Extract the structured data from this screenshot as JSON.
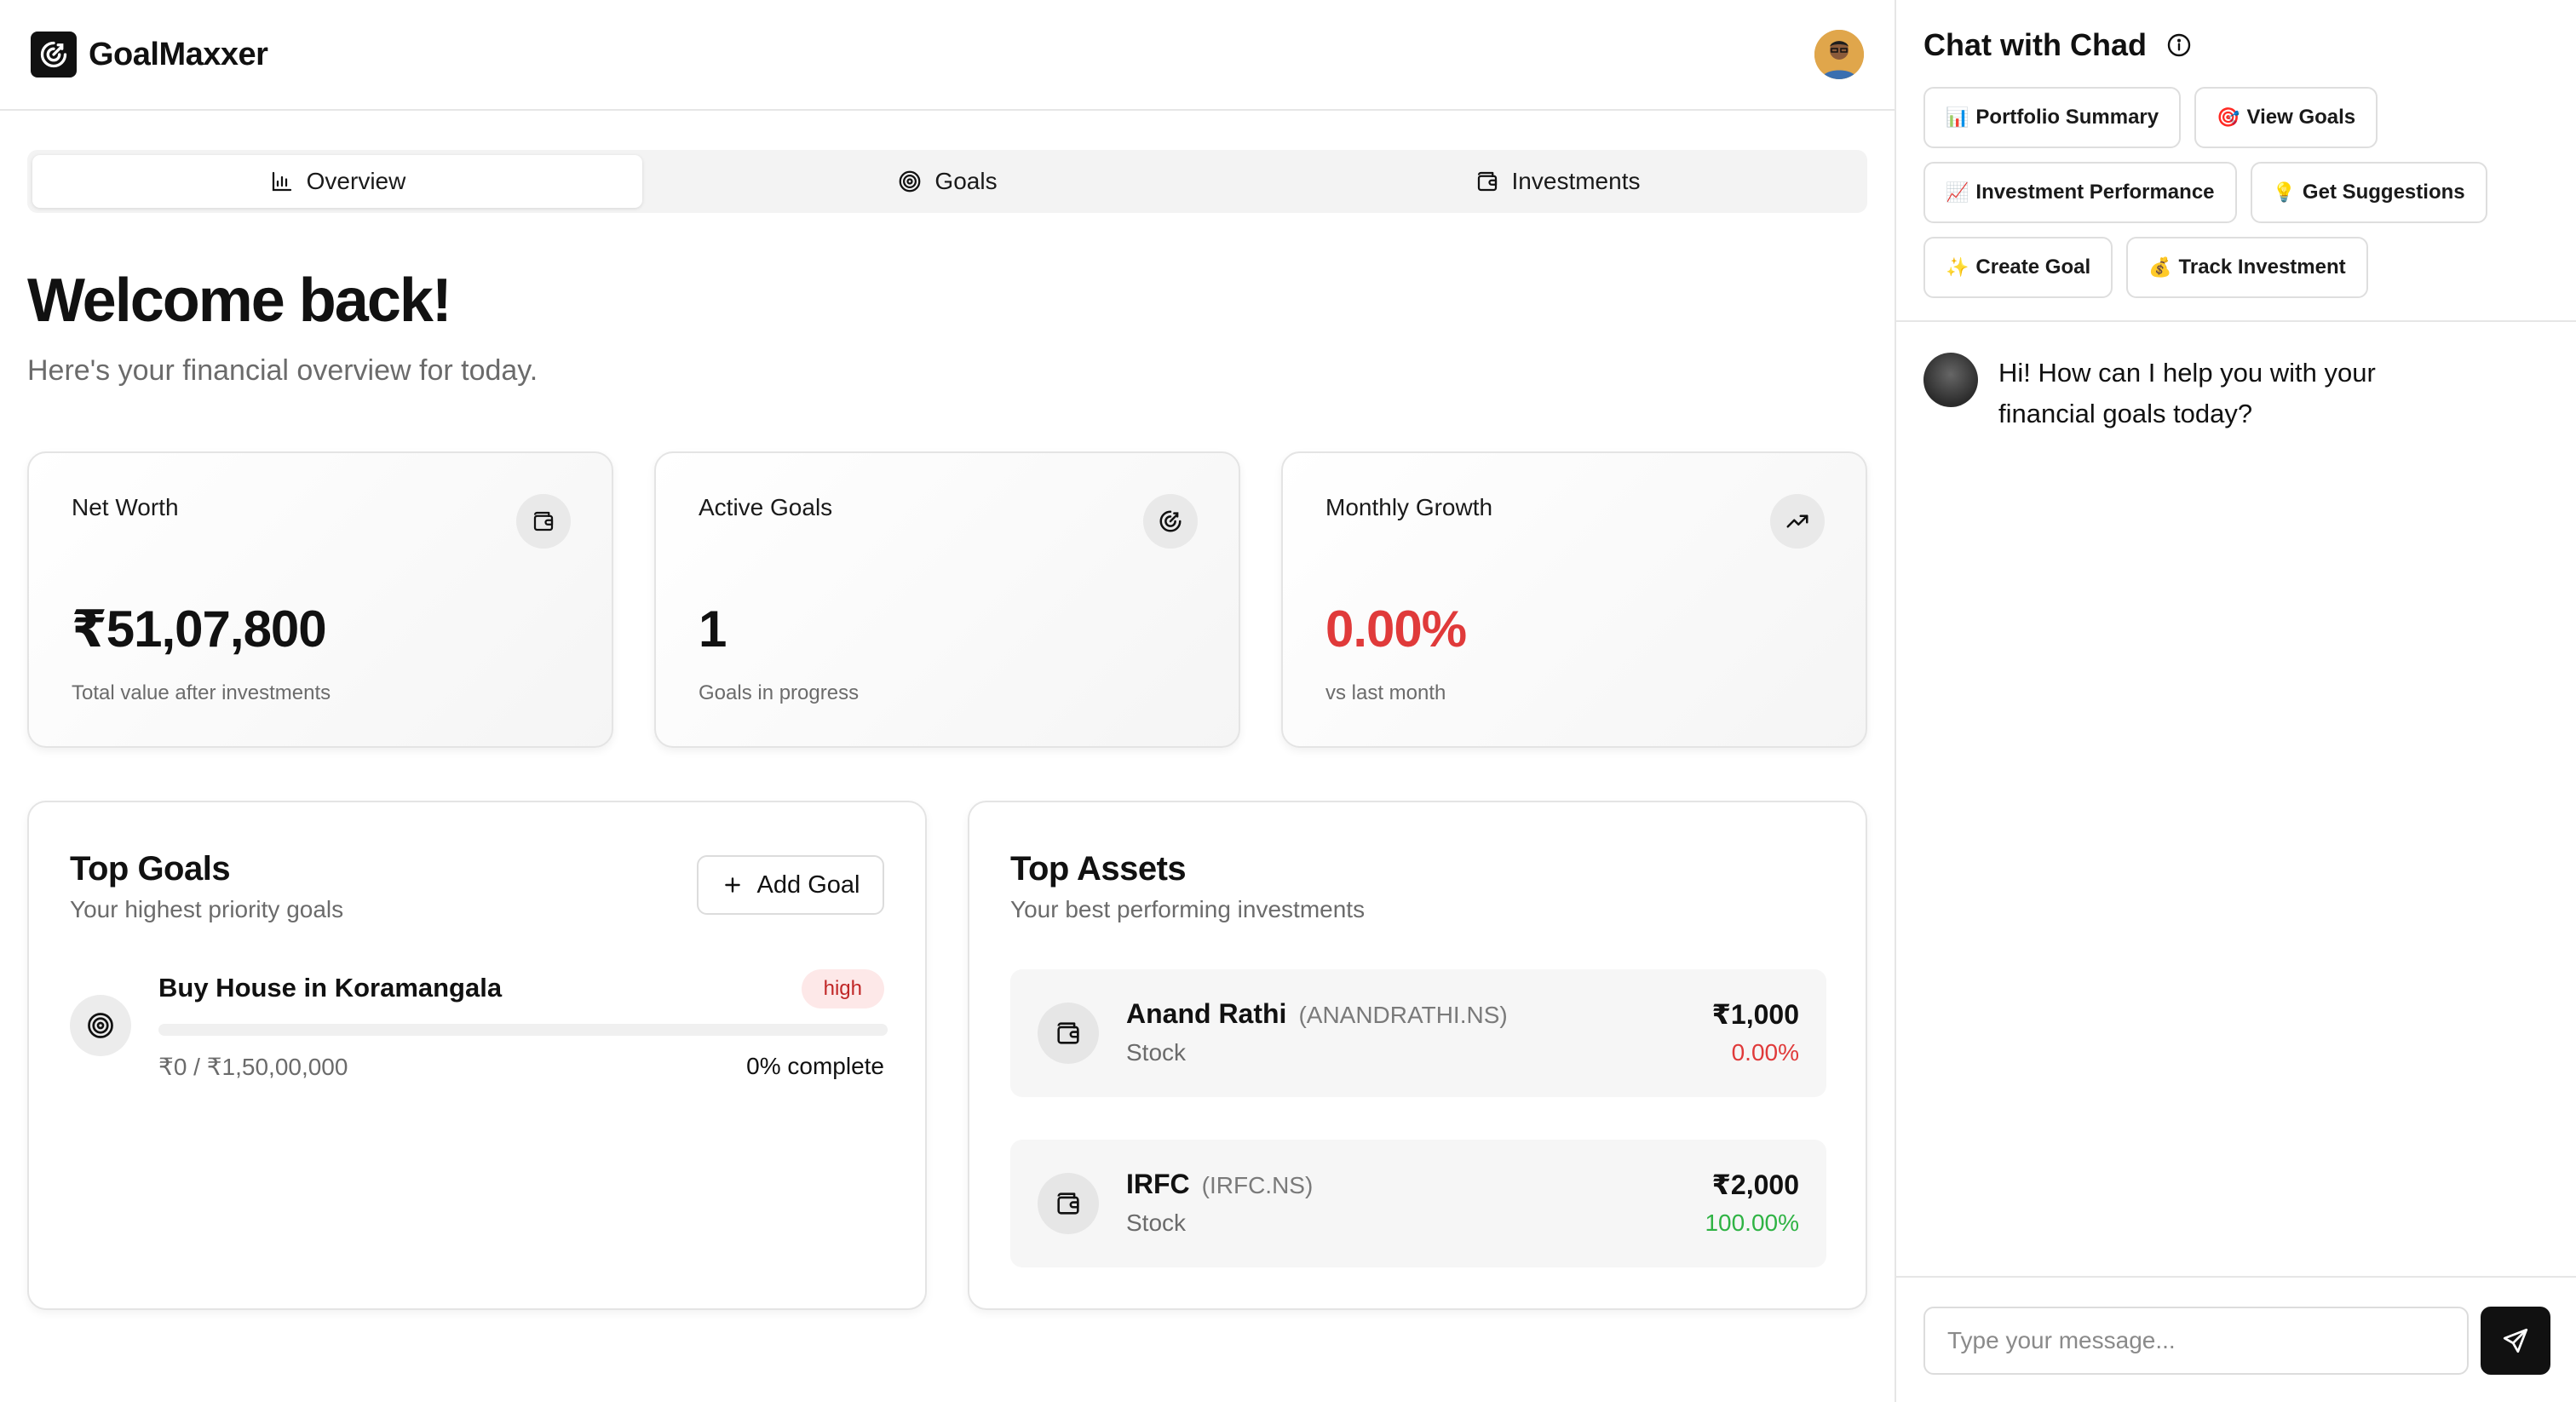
{
  "app": {
    "name": "GoalMaxxer",
    "logo_icon": "goal-target-icon"
  },
  "tabs": [
    {
      "label": "Overview",
      "icon": "chart-icon",
      "active": true
    },
    {
      "label": "Goals",
      "icon": "target-icon",
      "active": false
    },
    {
      "label": "Investments",
      "icon": "wallet-icon",
      "active": false
    }
  ],
  "welcome": {
    "title": "Welcome back!",
    "subtitle": "Here's your financial overview for today."
  },
  "stats": [
    {
      "title": "Net Worth",
      "value": "₹51,07,800",
      "sub": "Total value after investments",
      "icon": "wallet-icon"
    },
    {
      "title": "Active Goals",
      "value": "1",
      "sub": "Goals in progress",
      "icon": "goal-target-icon"
    },
    {
      "title": "Monthly Growth",
      "value": "0.00%",
      "sub": "vs last month",
      "icon": "trending-up-icon",
      "color": "#e03a3a"
    }
  ],
  "top_goals": {
    "title": "Top Goals",
    "subtitle": "Your highest priority goals",
    "add_label": "Add Goal",
    "items": [
      {
        "name": "Buy House in Koramangala",
        "priority": "high",
        "amount": "₹0 / ₹1,50,00,000",
        "progress_label": "0% complete",
        "progress": 0
      }
    ]
  },
  "top_assets": {
    "title": "Top Assets",
    "subtitle": "Your best performing investments",
    "items": [
      {
        "name": "Anand Rathi",
        "ticker": "(ANANDRATHI.NS)",
        "type": "Stock",
        "value": "₹1,000",
        "change": "0.00%",
        "change_color": "#e03a3a"
      },
      {
        "name": "IRFC",
        "ticker": "(IRFC.NS)",
        "type": "Stock",
        "value": "₹2,000",
        "change": "100.00%",
        "change_color": "#2fb344"
      }
    ]
  },
  "chat": {
    "title": "Chat with Chad",
    "chips": [
      {
        "emoji": "📊",
        "label": "Portfolio Summary"
      },
      {
        "emoji": "🎯",
        "label": "View Goals"
      },
      {
        "emoji": "📈",
        "label": "Investment Performance"
      },
      {
        "emoji": "💡",
        "label": "Get Suggestions"
      },
      {
        "emoji": "✨",
        "label": "Create Goal"
      },
      {
        "emoji": "💰",
        "label": "Track Investment"
      }
    ],
    "messages": [
      {
        "from": "bot",
        "text": "Hi! How can I help you with your financial goals today?"
      }
    ],
    "input_placeholder": "Type your message..."
  },
  "colors": {
    "negative": "#e03a3a",
    "positive": "#2fb344",
    "badge_bg": "#fde8e8",
    "badge_text": "#c02626"
  }
}
